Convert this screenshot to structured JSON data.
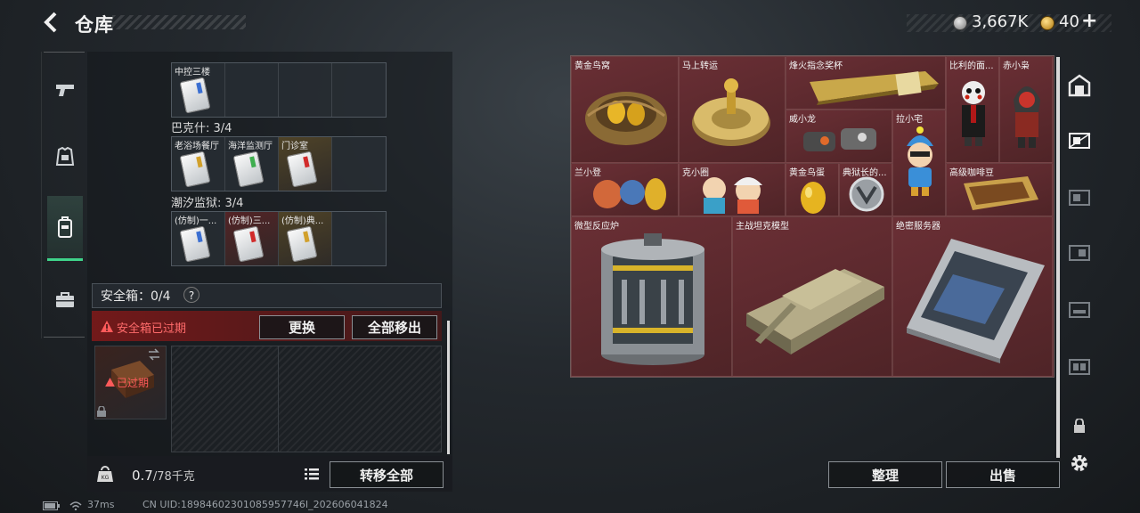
{
  "header": {
    "title": "仓库",
    "currency_value": "3,667K",
    "gold_value": "40",
    "gold_plus": "+"
  },
  "left_nav": {
    "tabs": [
      {
        "name": "weapons",
        "icon": "pistol-icon"
      },
      {
        "name": "armor",
        "icon": "armor-icon"
      },
      {
        "name": "backpack",
        "icon": "backpack-icon",
        "active": true
      },
      {
        "name": "briefcase",
        "icon": "briefcase-icon"
      }
    ]
  },
  "key_groups": [
    {
      "label": "",
      "cells": [
        {
          "label": "中控三楼",
          "card": "blue"
        },
        {
          "label": ""
        },
        {
          "label": ""
        },
        {
          "label": ""
        }
      ]
    },
    {
      "label": "巴克什: 3/4",
      "cells": [
        {
          "label": "老浴场餐厅",
          "card": "gold"
        },
        {
          "label": "海洋监测厅",
          "card": "green"
        },
        {
          "label": "门诊室",
          "card": "red",
          "tint": "gold"
        },
        {
          "label": ""
        }
      ]
    },
    {
      "label": "潮汐监狱: 3/4",
      "cells": [
        {
          "label": "(仿制)一...",
          "card": "blue"
        },
        {
          "label": "(仿制)三...",
          "card": "red",
          "tint": "red"
        },
        {
          "label": "(仿制)典...",
          "card": "gold",
          "tint": "gold"
        },
        {
          "label": ""
        }
      ]
    }
  ],
  "safe_box": {
    "label": "安全箱：0/4",
    "help": "?",
    "expired_text": "安全箱已过期",
    "replace_button": "更换",
    "remove_all_button": "全部移出",
    "item_label": "已过期"
  },
  "weight": {
    "current": "0.7",
    "max": "/78千克"
  },
  "transfer_all_button": "转移全部",
  "stash_items": [
    {
      "label": "黄金鸟窝"
    },
    {
      "label": "马上转运"
    },
    {
      "label": "烽火指念奖杯"
    },
    {
      "label": "比利的面..."
    },
    {
      "label": "赤小枭"
    },
    {
      "label": "威小龙"
    },
    {
      "label": "拉小宅"
    },
    {
      "label": "兰小登"
    },
    {
      "label": "克小圈"
    },
    {
      "label": "黄金鸟蛋"
    },
    {
      "label": "典狱长的..."
    },
    {
      "label": "高级咖啡豆"
    },
    {
      "label": "微型反应炉"
    },
    {
      "label": "主战坦克模型"
    },
    {
      "label": "绝密服务器"
    }
  ],
  "bottom_buttons": {
    "organize": "整理",
    "sell": "出售"
  },
  "right_nav": {
    "icons": [
      "vault-icon",
      "card-icon-1",
      "card-icon-2",
      "card-icon-3",
      "card-icon-4",
      "card-icon-5",
      "lock-icon",
      "settings-icon"
    ]
  },
  "status_bar": {
    "ping": "37ms",
    "uid": "CN UID:18984602301085957746I_202606041824"
  },
  "colors": {
    "accent_green": "#3fd38a",
    "expired_red": "#ff5a5a",
    "stash_bg": "#5b2a2e"
  }
}
